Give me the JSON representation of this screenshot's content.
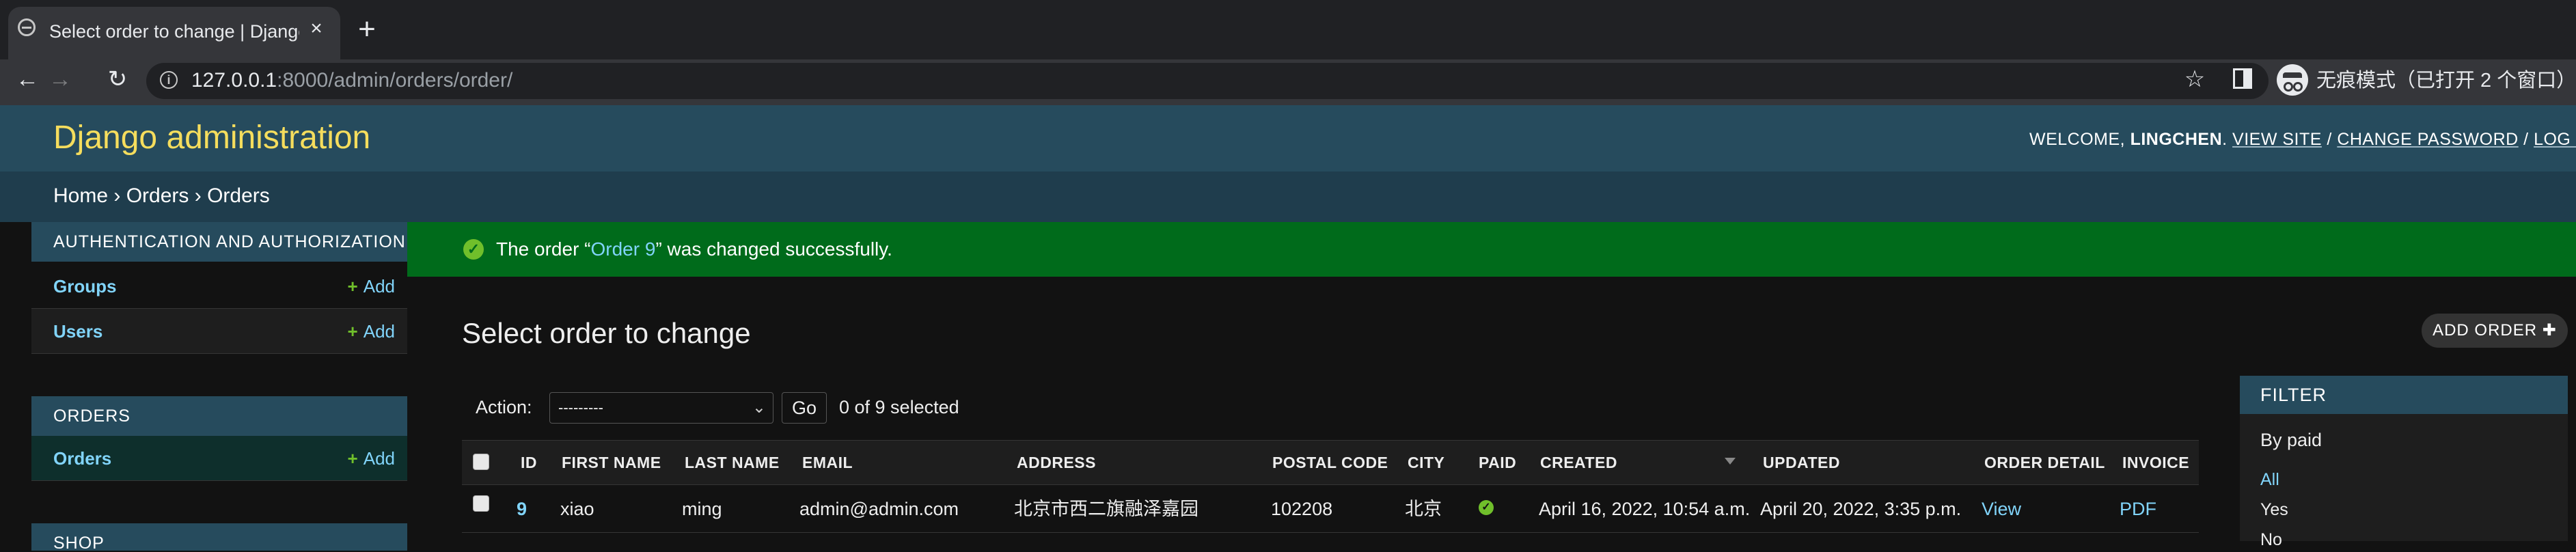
{
  "browser": {
    "tab_title": "Select order to change | Django site admin",
    "tab_close": "×",
    "new_tab": "+",
    "back": "←",
    "forward": "→",
    "reload": "↻",
    "url_host": "127.0.0.1",
    "url_rest": ":8000/admin/orders/order/",
    "star": "☆",
    "incognito_label": "无痕模式（已打开 2 个窗口）"
  },
  "header": {
    "branding": "Django administration",
    "welcome": "WELCOME,",
    "username": "LINGCHEN",
    "view_site": "VIEW SITE",
    "change_password": "CHANGE PASSWORD",
    "log_out": "LOG OUT",
    "sep": "/"
  },
  "breadcrumbs": {
    "home": "Home",
    "app": "Orders",
    "model": "Orders",
    "sep": "›"
  },
  "sidebar": {
    "auth_caption": "AUTHENTICATION AND AUTHORIZATION",
    "groups": "Groups",
    "users": "Users",
    "orders_caption": "ORDERS",
    "orders": "Orders",
    "shop_caption": "SHOP",
    "add_label": "Add",
    "plus": "+"
  },
  "message": {
    "prefix": "The order “",
    "link": "Order 9",
    "suffix": "” was changed successfully.",
    "icon": "✓"
  },
  "content": {
    "title": "Select order to change",
    "add_button": "ADD ORDER",
    "add_plus": "✚"
  },
  "actions": {
    "label": "Action:",
    "selected": "---------",
    "go": "Go",
    "counter": "0 of 9 selected",
    "chevron": "⌄"
  },
  "table": {
    "headers": [
      "ID",
      "FIRST NAME",
      "LAST NAME",
      "EMAIL",
      "ADDRESS",
      "POSTAL CODE",
      "CITY",
      "PAID",
      "CREATED",
      "UPDATED",
      "ORDER DETAIL",
      "INVOICE"
    ],
    "rows": [
      {
        "id": "9",
        "first_name": "xiao",
        "last_name": "ming",
        "email": "admin@admin.com",
        "address": "北京市西二旗融泽嘉园",
        "postal_code": "102208",
        "city": "北京",
        "paid": "✓",
        "created": "April 16, 2022, 10:54 a.m.",
        "updated": "April 20, 2022, 3:35 p.m.",
        "order_detail": "View",
        "invoice": "PDF"
      }
    ]
  },
  "filter": {
    "title": "FILTER",
    "by": "By paid",
    "options": [
      "All",
      "Yes",
      "No"
    ],
    "selected": "All"
  },
  "colors": {
    "header_bg": "#264b5d",
    "branding": "#f5dd5d",
    "link": "#81d4fa",
    "success_bg": "#006b1b",
    "add_green": "#70bf2b",
    "page_bg": "#121212"
  }
}
